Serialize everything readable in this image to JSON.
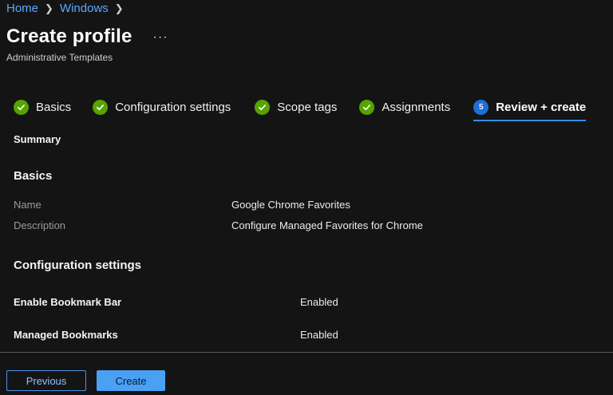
{
  "breadcrumb": {
    "items": [
      "Home",
      "Windows"
    ]
  },
  "header": {
    "title": "Create profile",
    "more_label": "···",
    "subtitle": "Administrative Templates"
  },
  "steps": [
    {
      "label": "Basics",
      "status": "complete"
    },
    {
      "label": "Configuration settings",
      "status": "complete"
    },
    {
      "label": "Scope tags",
      "status": "complete"
    },
    {
      "label": "Assignments",
      "status": "complete"
    },
    {
      "label": "Review + create",
      "status": "active",
      "number": "5"
    }
  ],
  "summary": {
    "label": "Summary",
    "basics": {
      "heading": "Basics",
      "rows": [
        {
          "key": "Name",
          "value": "Google Chrome Favorites"
        },
        {
          "key": "Description",
          "value": "Configure Managed Favorites for Chrome"
        }
      ]
    },
    "configuration": {
      "heading": "Configuration settings",
      "rows": [
        {
          "key": "Enable Bookmark Bar",
          "value": "Enabled"
        },
        {
          "key": "Managed Bookmarks",
          "value": "Enabled"
        }
      ]
    }
  },
  "footer": {
    "previous_label": "Previous",
    "create_label": "Create"
  },
  "colors": {
    "background": "#141414",
    "link": "#5aa9ff",
    "success": "#57a300",
    "accent": "#2f8fe8",
    "primary_button": "#4aa0f5"
  }
}
